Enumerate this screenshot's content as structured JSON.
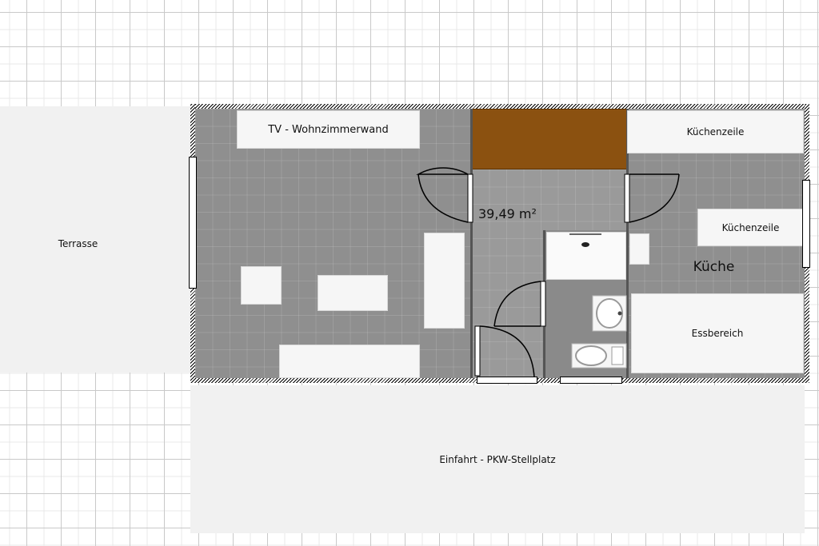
{
  "labels": {
    "terrasse": "Terrasse",
    "einfahrt": "Einfahrt - PKW-Stellplatz",
    "tv_wall": "TV - Wohnzimmerwand",
    "kuechenzeile_top": "Küchenzeile",
    "kuechenzeile_right": "Küchenzeile",
    "kueche": "Küche",
    "essbereich": "Essbereich",
    "area": "39,49 m²"
  },
  "colors": {
    "wall": "#000000",
    "floor_living": "#8f8f8f",
    "floor_hall": "#9a9a9a",
    "storage_brown": "#8b5110",
    "furniture": "#f6f6f6",
    "outdoor": "#f1f1f1"
  }
}
